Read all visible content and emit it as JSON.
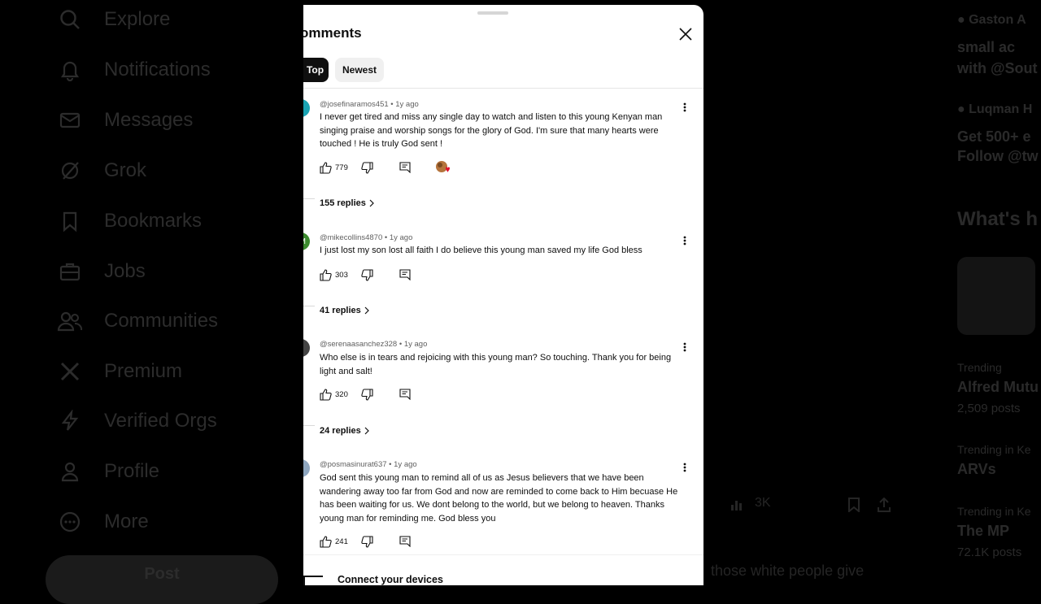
{
  "background": {
    "nav": [
      "Explore",
      "Notifications",
      "Messages",
      "Grok",
      "Bookmarks",
      "Jobs",
      "Communities",
      "Premium",
      "Verified Orgs",
      "Profile",
      "More"
    ],
    "post_button": "Post",
    "right": {
      "user1": "Gaston A",
      "line1": "small ac",
      "line2": "with @Sout",
      "user2": "Luqman H",
      "line3": "Get 500+ e",
      "line4": "Follow @tw",
      "whats": "What's h",
      "trend1_meta": "Trending",
      "trend1": "Alfred Mutu",
      "trend1_posts": "2,509 posts",
      "trend2_meta": "Trending in Ke",
      "trend2": "ARVs",
      "trend3_meta": "Trending in Ke",
      "trend3": "The MP",
      "trend3_posts": "72.1K posts"
    },
    "mid": {
      "count": "3K",
      "tail": "those white people give"
    }
  },
  "sheet": {
    "title": "omments",
    "tabs": [
      {
        "label": "Top"
      },
      {
        "label": "Newest"
      }
    ],
    "comments": [
      {
        "author": "@josefinaramos451",
        "time": "1y ago",
        "text": "I never get tired and miss any single day to watch and listen to this young Kenyan man singing praise and worship songs for the glory of God.  I'm sure that many hearts were touched !  He is truly God sent !",
        "likes": "779",
        "replies": "155 replies",
        "avatar_color": "#1aa3b3"
      },
      {
        "author": "@mikecollins4870",
        "time": "1y ago",
        "text": "I just lost my son lost all faith I do believe this young man saved my life God bless",
        "likes": "303",
        "replies": "41 replies",
        "avatar_color": "#3b8a2e",
        "avatar_letter": "M"
      },
      {
        "author": "@serenaasanchez328",
        "time": "1y ago",
        "text": "Who else is in tears and rejoicing with this young man? So touching. Thank you for being light and salt!",
        "likes": "320",
        "replies": "24 replies",
        "avatar_color": "#444444"
      },
      {
        "author": "@posmasinurat637",
        "time": "1y ago",
        "text": "God sent this young man to remind all of us as Jesus believers that we have been wandering away too far from God and now are reminded to come back to Him becuase He has been waiting for us. We dont belong to the world, but we belong to heaven. Thanks young man for reminding me. God bless you",
        "likes": "241",
        "avatar_color": "#8fa7c0"
      }
    ],
    "footer": "Connect your devices"
  }
}
